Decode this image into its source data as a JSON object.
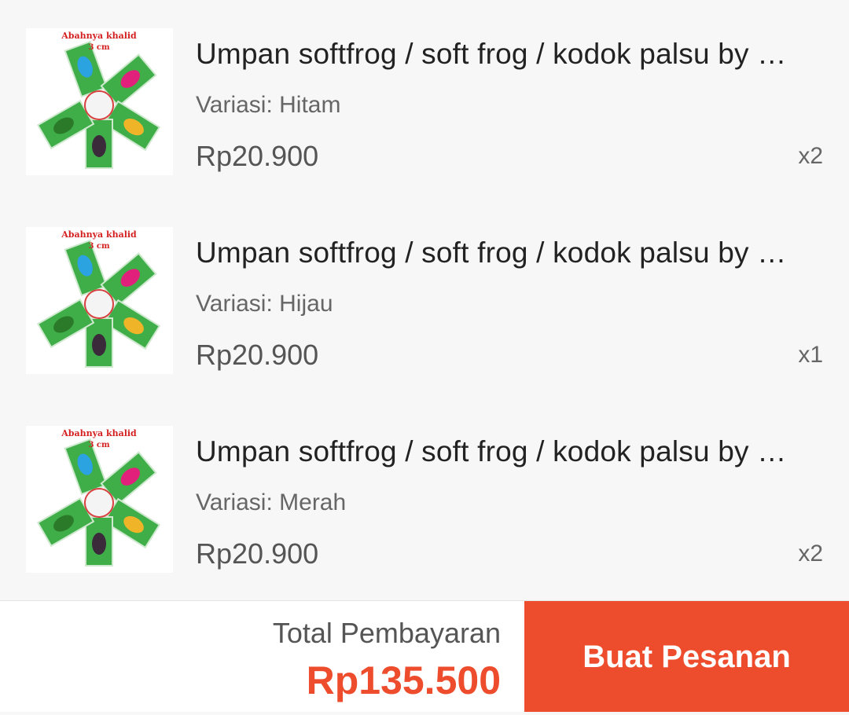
{
  "items": [
    {
      "image_caption": "Abahnya khalid",
      "image_subcaption": "3 cm",
      "title": "Umpan softfrog / soft frog / kodok palsu by …",
      "variant": "Variasi: Hitam",
      "price": "Rp20.900",
      "quantity": "x2"
    },
    {
      "image_caption": "Abahnya khalid",
      "image_subcaption": "3 cm",
      "title": "Umpan softfrog / soft frog / kodok palsu by …",
      "variant": "Variasi: Hijau",
      "price": "Rp20.900",
      "quantity": "x1"
    },
    {
      "image_caption": "Abahnya khalid",
      "image_subcaption": "3 cm",
      "title": "Umpan softfrog / soft frog / kodok palsu by …",
      "variant": "Variasi: Merah",
      "price": "Rp20.900",
      "quantity": "x2"
    }
  ],
  "footer": {
    "total_label": "Total Pembayaran",
    "total_value": "Rp135.500",
    "order_button_label": "Buat Pesanan"
  },
  "colors": {
    "accent": "#ee4d2d",
    "background": "#f7f7f7",
    "card_green": "#3fae49",
    "frog_pink": "#e0207a",
    "frog_blue": "#2aa3e0",
    "frog_yellow": "#f0b428",
    "frog_dark": "#3a2a3a"
  }
}
